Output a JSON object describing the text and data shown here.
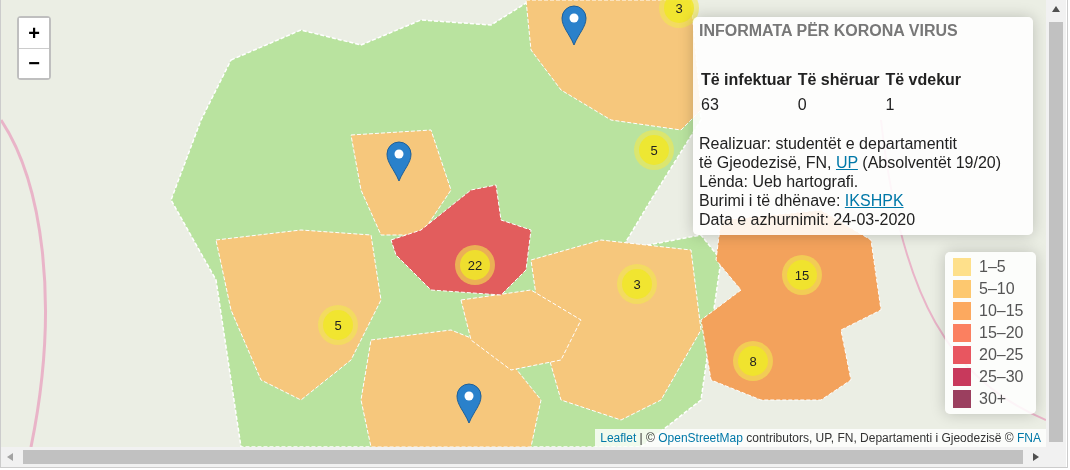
{
  "zoom_controls": [
    "+",
    "−"
  ],
  "clusters": [
    {
      "count": "3"
    },
    {
      "count": "5"
    },
    {
      "count": "22"
    },
    {
      "count": "5"
    },
    {
      "count": "3"
    },
    {
      "count": "15"
    },
    {
      "count": "8"
    }
  ],
  "info_panel": {
    "title": "INFORMATA PËR KORONA VIRUS",
    "columns": [
      "Të infektuar",
      "Të shëruar",
      "Të vdekur"
    ],
    "values": [
      "63",
      "0",
      "1"
    ],
    "lines": [
      [
        {
          "text": "Realizuar: studentët e departamentit"
        }
      ],
      [
        {
          "text": "të Gjeodezisë, FN, "
        },
        {
          "link": "UP"
        },
        {
          "text": " (Absolventët 19/20)"
        }
      ],
      [
        {
          "text": "Lënda: Ueb hartografi."
        }
      ],
      [
        {
          "text": "Burimi i të dhënave: "
        },
        {
          "link": "IKSHPK"
        }
      ],
      [
        {
          "text": "Data e azhurnimit: 24-03-2020"
        }
      ]
    ]
  },
  "legend": [
    {
      "label": "1–5",
      "color": "#fee08b"
    },
    {
      "label": "5–10",
      "color": "#fdc86f"
    },
    {
      "label": "10–15",
      "color": "#fca95f"
    },
    {
      "label": "15–20",
      "color": "#fb8060"
    },
    {
      "label": "20–25",
      "color": "#e85660"
    },
    {
      "label": "25–30",
      "color": "#c8395c"
    },
    {
      "label": "30+",
      "color": "#9b3f5f"
    }
  ],
  "attribution": [
    {
      "link": "Leaflet"
    },
    {
      "text": " | © "
    },
    {
      "link": "OpenStreetMap"
    },
    {
      "text": " contributors, UP, FN, Departamenti i Gjeodezisë © "
    },
    {
      "link": "FNA"
    }
  ]
}
